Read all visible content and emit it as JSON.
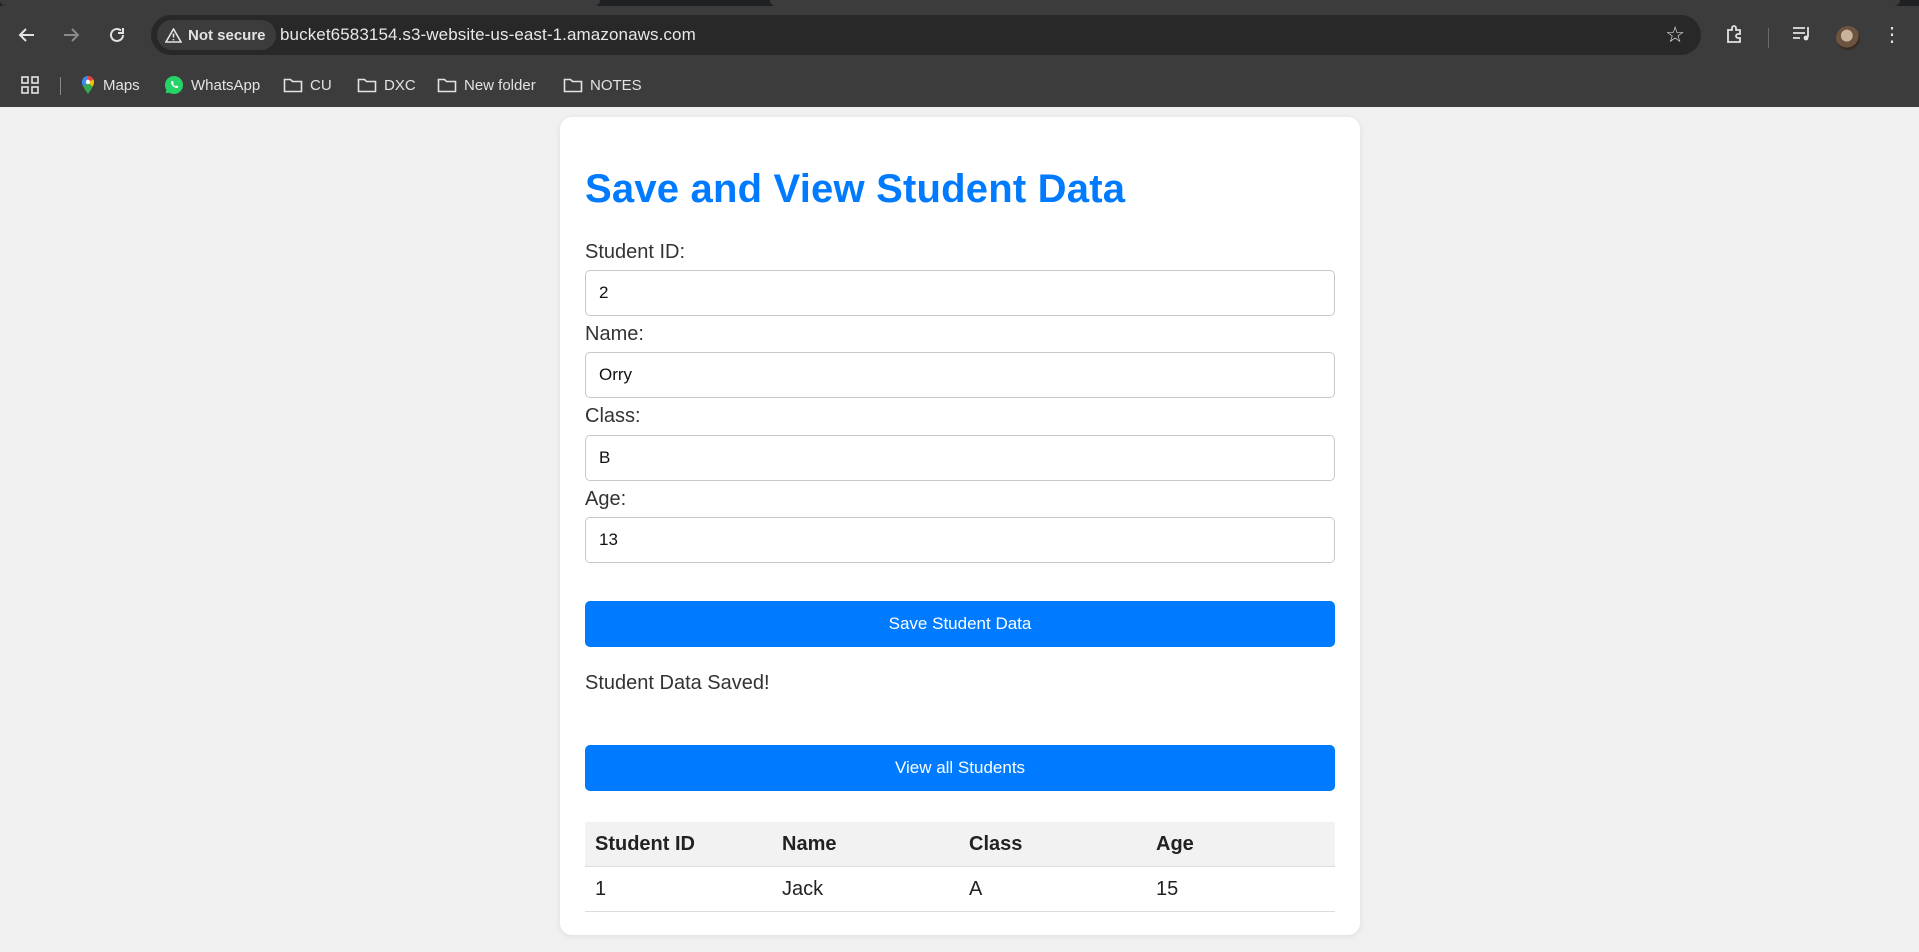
{
  "browser": {
    "security_label": "Not secure",
    "url": "bucket6583154.s3-website-us-east-1.amazonaws.com",
    "bookmarks": [
      {
        "label": "Maps",
        "icon": "maps-pin-icon"
      },
      {
        "label": "WhatsApp",
        "icon": "whatsapp-icon"
      },
      {
        "label": "CU",
        "icon": "folder-icon"
      },
      {
        "label": "DXC",
        "icon": "folder-icon"
      },
      {
        "label": "New folder",
        "icon": "folder-icon"
      },
      {
        "label": "NOTES",
        "icon": "folder-icon"
      }
    ]
  },
  "page": {
    "title": "Save and View Student Data",
    "form": {
      "fields": [
        {
          "label": "Student ID:",
          "value": "2"
        },
        {
          "label": "Name:",
          "value": "Orry"
        },
        {
          "label": "Class:",
          "value": "B"
        },
        {
          "label": "Age:",
          "value": "13"
        }
      ],
      "save_label": "Save Student Data"
    },
    "status": "Student Data Saved!",
    "view_label": "View all Students",
    "table": {
      "headers": [
        "Student ID",
        "Name",
        "Class",
        "Age"
      ],
      "rows": [
        [
          "1",
          "Jack",
          "A",
          "15"
        ]
      ]
    }
  },
  "colors": {
    "accent": "#007bff",
    "page_background": "#f0f0f0",
    "chrome_background": "#3c3c3c"
  }
}
